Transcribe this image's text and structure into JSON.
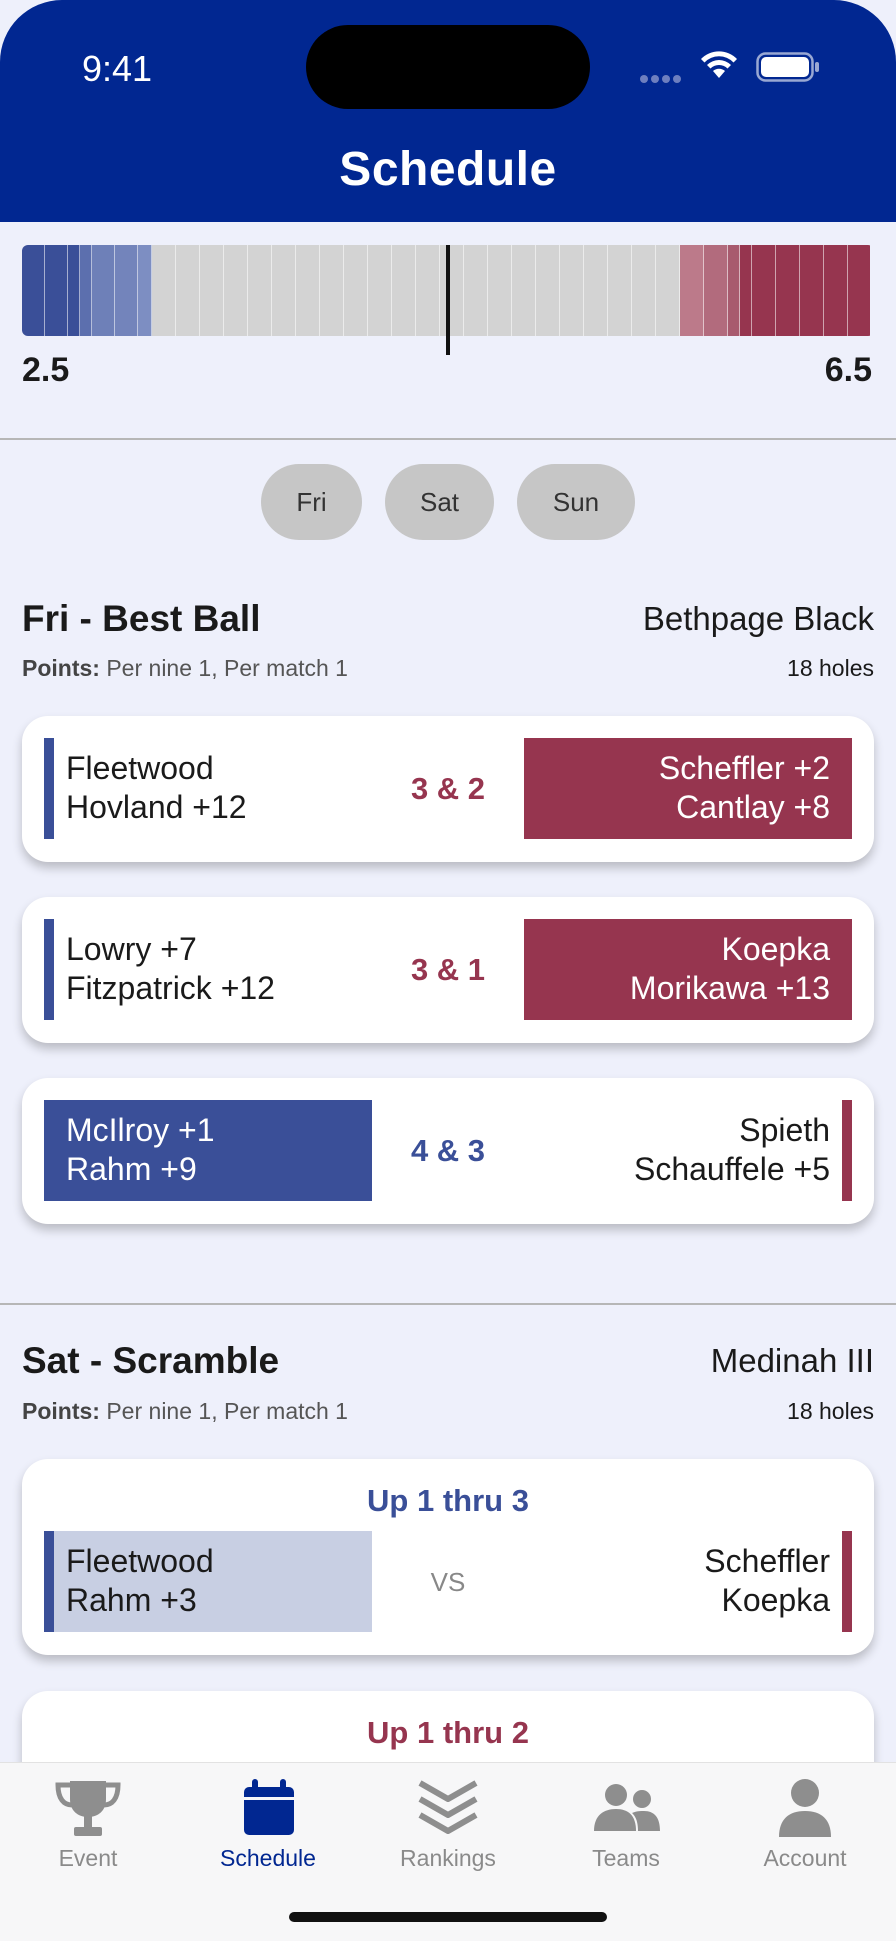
{
  "status_bar": {
    "time": "9:41"
  },
  "header": {
    "title": "Schedule"
  },
  "score": {
    "left": "2.5",
    "right": "6.5"
  },
  "day_tabs": [
    {
      "label": "Fri"
    },
    {
      "label": "Sat"
    },
    {
      "label": "Sun"
    }
  ],
  "sections": [
    {
      "title": "Fri - Best Ball",
      "course": "Bethpage Black",
      "points_label": "Points:",
      "points_value": "Per nine 1, Per match 1",
      "holes": "18 holes",
      "matches": [
        {
          "left_line1": "Fleetwood",
          "left_line2": "Hovland +12",
          "result": "3 & 2",
          "right_line1": "Scheffler +2",
          "right_line2": "Cantlay +8"
        },
        {
          "left_line1": "Lowry +7",
          "left_line2": "Fitzpatrick +12",
          "result": "3 & 1",
          "right_line1": "Koepka",
          "right_line2": "Morikawa +13"
        },
        {
          "left_line1": "McIlroy +1",
          "left_line2": "Rahm +9",
          "result": "4 & 3",
          "right_line1": "Spieth",
          "right_line2": "Schauffele +5"
        }
      ]
    },
    {
      "title": "Sat - Scramble",
      "course": "Medinah III",
      "points_label": "Points:",
      "points_value": "Per nine 1, Per match 1",
      "holes": "18 holes",
      "matches": [
        {
          "status": "Up 1 thru 3",
          "left_line1": "Fleetwood",
          "left_line2": "Rahm  +3",
          "vs": "VS",
          "right_line1": "Scheffler",
          "right_line2": "Koepka"
        },
        {
          "status": "Up 1 thru 2"
        }
      ]
    }
  ],
  "tab_bar": [
    {
      "label": "Event",
      "icon": "trophy-icon"
    },
    {
      "label": "Schedule",
      "icon": "calendar-icon"
    },
    {
      "label": "Rankings",
      "icon": "chevrons-icon"
    },
    {
      "label": "Teams",
      "icon": "people-icon"
    },
    {
      "label": "Account",
      "icon": "person-icon"
    }
  ],
  "colors": {
    "header_blue": "#012791",
    "team_blue": "#3a4f98",
    "team_red": "#96354f",
    "background": "#eef0fb"
  }
}
